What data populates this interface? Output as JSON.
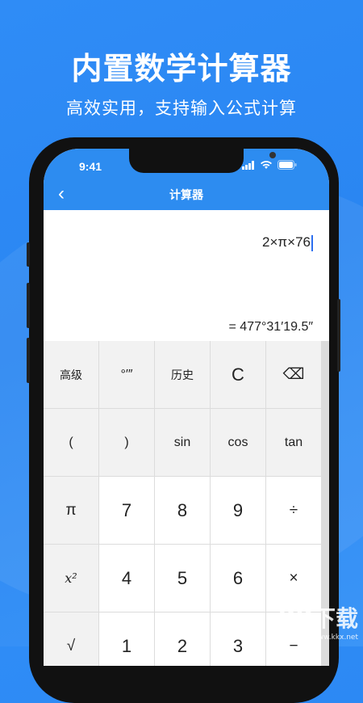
{
  "promo": {
    "headline": "内置数学计算器",
    "subline": "高效实用，支持输入公式计算"
  },
  "status_bar": {
    "time": "9:41"
  },
  "nav": {
    "back_icon": "‹",
    "title": "计算器"
  },
  "display": {
    "expression": "2×π×76",
    "result": "= 477°31′19.5″"
  },
  "keypad": {
    "row1": [
      "高级",
      "°′″",
      "历史",
      "C",
      "⌫"
    ],
    "row2": [
      "(",
      ")",
      "sin",
      "cos",
      "tan"
    ],
    "row3": [
      "π",
      "7",
      "8",
      "9",
      "÷"
    ],
    "row4": [
      "x²",
      "4",
      "5",
      "6",
      "×"
    ],
    "row5": [
      "√",
      "1",
      "2",
      "3",
      "−"
    ]
  },
  "watermark": {
    "text": "KK下载",
    "url": "www.kkx.net"
  },
  "colors": {
    "brand_blue": "#2d8cf0",
    "caret": "#2d6ff0"
  }
}
